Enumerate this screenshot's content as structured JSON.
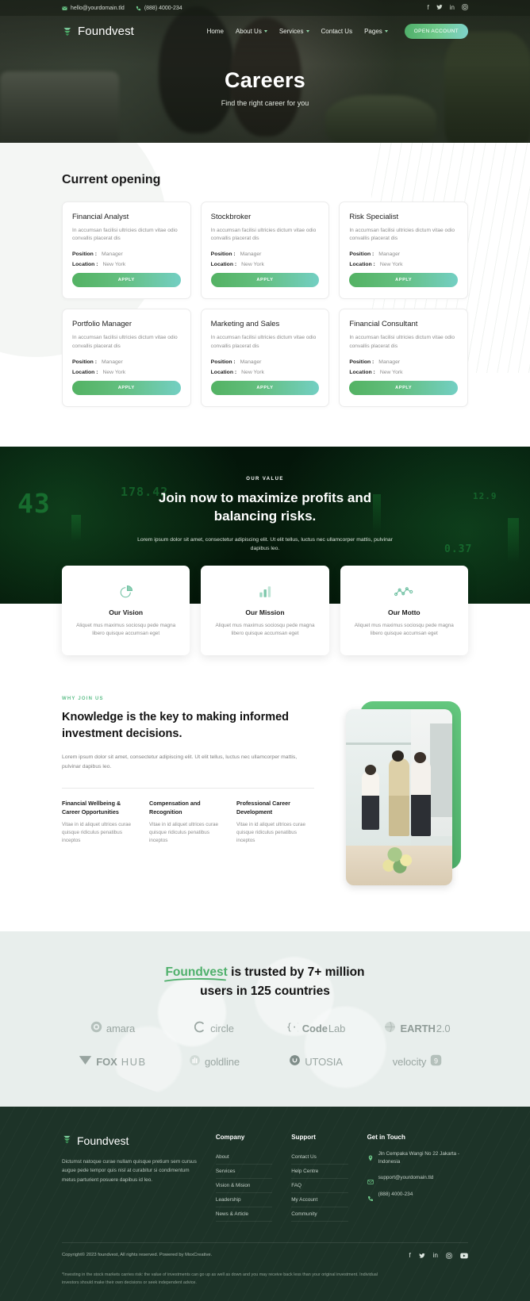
{
  "topbar": {
    "email": "hello@yourdomain.tld",
    "phone": "(888) 4000-234",
    "social": [
      "facebook",
      "twitter",
      "linkedin",
      "instagram"
    ]
  },
  "nav": {
    "brand": "Foundvest",
    "links": [
      {
        "label": "Home",
        "caret": false
      },
      {
        "label": "About Us",
        "caret": true
      },
      {
        "label": "Services",
        "caret": true
      },
      {
        "label": "Contact Us",
        "caret": false
      },
      {
        "label": "Pages",
        "caret": true
      }
    ],
    "cta": "OPEN ACCOUNT"
  },
  "hero": {
    "title": "Careers",
    "subtitle": "Find the right career for you"
  },
  "openings": {
    "title": "Current opening",
    "position_label": "Position :",
    "location_label": "Location :",
    "apply_label": "APPLY",
    "jobs": [
      {
        "title": "Financial Analyst",
        "desc": "In accumsan facilisi ultricies dictum vitae odio convallis placerat dis",
        "position": "Manager",
        "location": "New York"
      },
      {
        "title": "Stockbroker",
        "desc": "In accumsan facilisi ultricies dictum vitae odio convallis placerat dis",
        "position": "Manager",
        "location": "New York"
      },
      {
        "title": "Risk Specialist",
        "desc": "In accumsan facilisi ultricies dictum vitae odio convallis placerat dis",
        "position": "Manager",
        "location": "New York"
      },
      {
        "title": "Portfolio Manager",
        "desc": "In accumsan facilisi ultricies dictum vitae odio convallis placerat dis",
        "position": "Manager",
        "location": "New York"
      },
      {
        "title": "Marketing and Sales",
        "desc": "In accumsan facilisi ultricies dictum vitae odio convallis placerat dis",
        "position": "Manager",
        "location": "New York"
      },
      {
        "title": "Financial Consultant",
        "desc": "In accumsan facilisi ultricies dictum vitae odio convallis placerat dis",
        "position": "Manager",
        "location": "New York"
      }
    ]
  },
  "value": {
    "eyebrow": "OUR VALUE",
    "title_line1": "Join now to maximize profits and",
    "title_line2": "balancing risks.",
    "desc": "Lorem ipsum dolor sit amet, consectetur adipiscing elit. Ut elit tellus, luctus nec ullamcorper mattis, pulvinar dapibus leo.",
    "bg_numbers": [
      "43",
      "178.42",
      "0.37",
      "12.9"
    ],
    "cards": [
      {
        "icon": "pie-chart-icon",
        "title": "Our Vision",
        "desc": "Aliquet mus maximus sociosqu pede magna libero quisque accumsan eget"
      },
      {
        "icon": "bar-chart-icon",
        "title": "Our Mission",
        "desc": "Aliquet mus maximus sociosqu pede magna libero quisque accumsan eget"
      },
      {
        "icon": "line-graph-icon",
        "title": "Our Motto",
        "desc": "Aliquet mus maximus sociosqu pede magna libero quisque accumsan eget"
      }
    ]
  },
  "why": {
    "eyebrow": "WHY JOIN US",
    "title": "Knowledge is the key to making informed investment decisions.",
    "desc": "Lorem ipsum dolor sit amet, consectetur adipiscing elit. Ut elit tellus, luctus nec ullamcorper mattis, pulvinar dapibus leo.",
    "features": [
      {
        "title": "Financial Wellbeing & Career Opportunities",
        "desc": "Vitae in id aliquet ultrices curae quisque ridiculus penatibus inceptos"
      },
      {
        "title": "Compensation and Recognition",
        "desc": "Vitae in id aliquet ultrices curae quisque ridiculus penatibus inceptos"
      },
      {
        "title": "Professional Career Development",
        "desc": "Vitae in id aliquet ultrices curae quisque ridiculus penatibus inceptos"
      }
    ]
  },
  "trusted": {
    "brand": "Foundvest",
    "headline_rest": " is trusted by 7+ million",
    "headline_line2": "users in 125 countries",
    "logos": [
      {
        "name": "amara",
        "icon": "target-circle-icon",
        "bold": "",
        "rest": "amara"
      },
      {
        "name": "circle",
        "icon": "c-ring-icon",
        "bold": "",
        "rest": "circle"
      },
      {
        "name": "CodeLab",
        "icon": "braces-icon",
        "bold": "Code",
        "rest": "Lab"
      },
      {
        "name": "EARTH2.0",
        "icon": "globe-icon",
        "bold": "EARTH",
        "rest": "2.0"
      },
      {
        "name": "FOXHUB",
        "icon": "fox-chevron-icon",
        "bold": "FOX",
        "rest": "HUB"
      },
      {
        "name": "goldline",
        "icon": "bars-circle-icon",
        "bold": "",
        "rest": "goldline"
      },
      {
        "name": "UTOSIA",
        "icon": "power-u-icon",
        "bold": "",
        "rest": "UTOSIA"
      },
      {
        "name": "velocity9",
        "icon": "nine-badge-icon",
        "bold": "",
        "rest": "velocity"
      }
    ]
  },
  "footer": {
    "brand": "Foundvest",
    "desc": "Dictumst natoque curae nullam quisque pretium sem cursus augue pede tempor quis nisl at curabitur si condimentum metus parturient posuere dapibus id leo.",
    "columns": [
      {
        "title": "Company",
        "links": [
          "About",
          "Services",
          "Vision & Mision",
          "Leadership",
          "News & Article"
        ]
      },
      {
        "title": "Support",
        "links": [
          "Contact Us",
          "Help Centre",
          "FAQ",
          "My Account",
          "Community"
        ]
      }
    ],
    "contact_title": "Get in Touch",
    "contact": [
      {
        "icon": "location-pin-icon",
        "text": "Jln Cempaka Wangi No 22 Jakarta - Indonesia"
      },
      {
        "icon": "envelope-icon",
        "text": "support@yourdomain.tld"
      },
      {
        "icon": "phone-icon",
        "text": "(888) 4000-234"
      }
    ],
    "copyright": "Copyright© 2023 foundvest, All rights reserved. Powered by MoxCreative.",
    "social": [
      "facebook",
      "twitter",
      "linkedin",
      "instagram",
      "youtube"
    ],
    "disclaimer": "*Investing in the stock markets carries risk: the value of investments can go up as well as down and you may receive back less than your original investment. Individual investors should make their own decisions or seek independent advice."
  }
}
